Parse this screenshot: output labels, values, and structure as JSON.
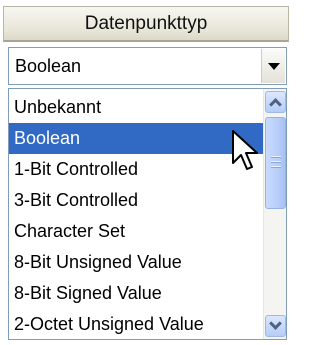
{
  "header": {
    "title": "Datenpunkttyp"
  },
  "combo": {
    "selected_value": "Boolean"
  },
  "dropdown": {
    "items": [
      "Unbekannt",
      "Boolean",
      "1-Bit Controlled",
      "3-Bit Controlled",
      "Character Set",
      "8-Bit Unsigned Value",
      "8-Bit Signed Value",
      "2-Octet Unsigned Value"
    ],
    "selected_index": 1
  },
  "colors": {
    "selection_bg": "#316ac5",
    "selection_fg": "#ffffff",
    "border": "#7f9db9",
    "header_bg": "#e8e6d8"
  },
  "icons": {
    "combo_button": "triangle-down-icon",
    "scroll_up": "chevron-up-icon",
    "scroll_down": "chevron-down-icon",
    "cursor": "arrow-cursor-icon"
  }
}
